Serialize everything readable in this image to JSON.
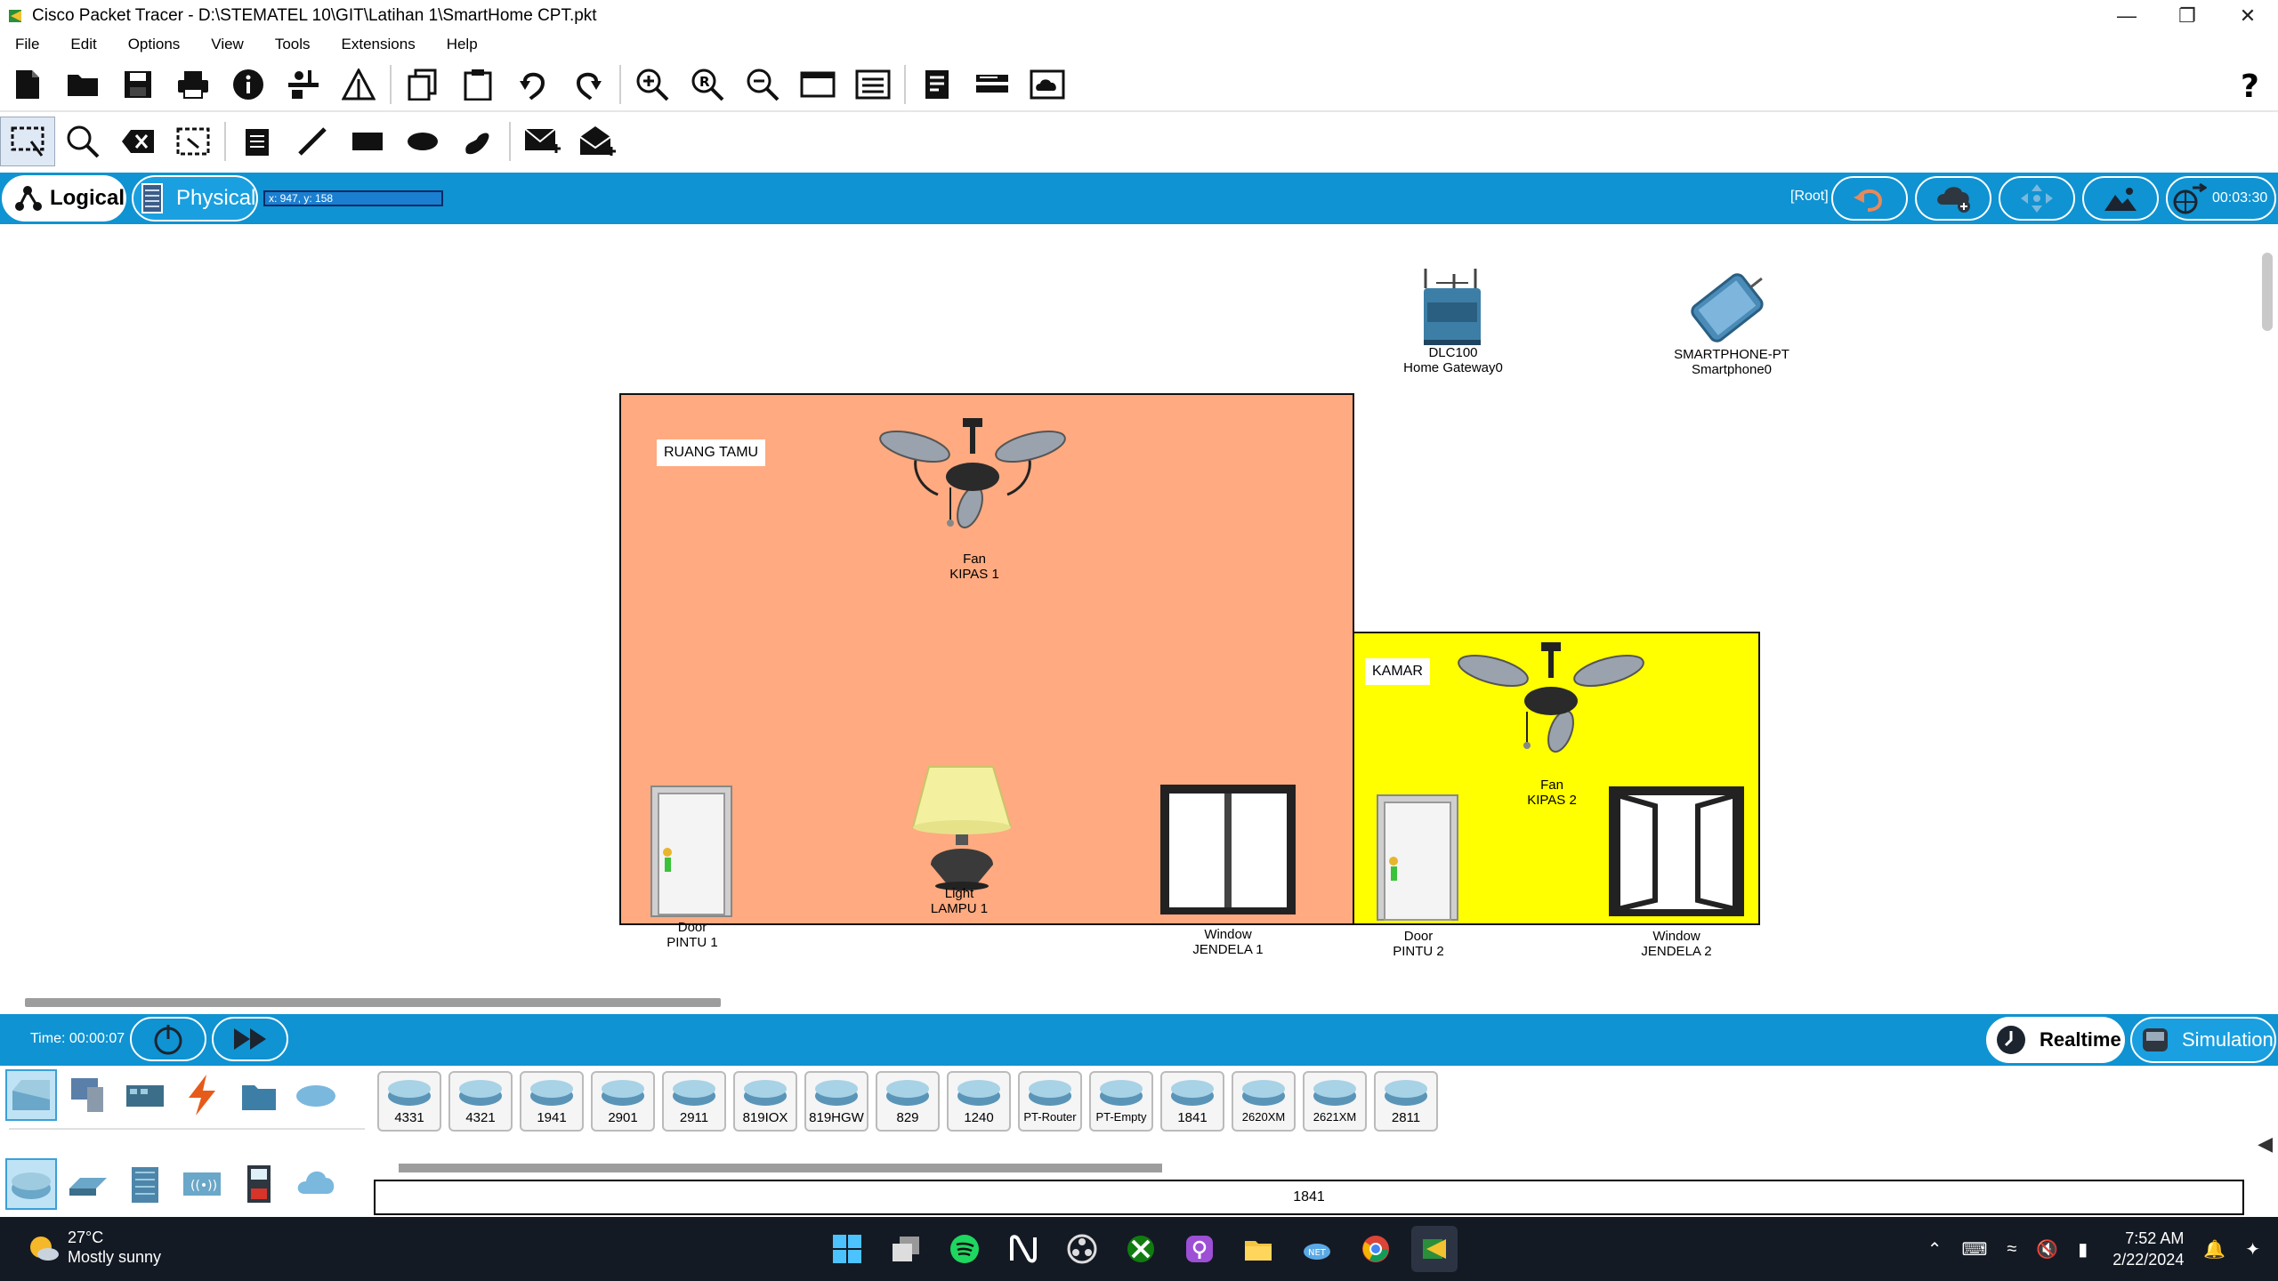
{
  "window": {
    "title": "Cisco Packet Tracer - D:\\STEMATEL 10\\GIT\\Latihan 1\\SmartHome CPT.pkt"
  },
  "menu": [
    "File",
    "Edit",
    "Options",
    "View",
    "Tools",
    "Extensions",
    "Help"
  ],
  "mode_bar": {
    "logical_label": "Logical",
    "physical_label": "Physical",
    "coords": "x: 947, y: 158",
    "root_label": "[Root]",
    "clock": "00:03:30"
  },
  "workspace": {
    "rooms": [
      {
        "label": "RUANG TAMU",
        "color": "#ffaa80"
      },
      {
        "label": "KAMAR",
        "color": "#ffff00"
      }
    ],
    "devices": [
      {
        "type": "DLC100",
        "name": "Home Gateway0"
      },
      {
        "type": "SMARTPHONE-PT",
        "name": "Smartphone0"
      },
      {
        "type": "Fan",
        "name": "KIPAS 1"
      },
      {
        "type": "Light",
        "name": "LAMPU 1"
      },
      {
        "type": "Door",
        "name": "PINTU 1"
      },
      {
        "type": "Window",
        "name": "JENDELA 1"
      },
      {
        "type": "Fan",
        "name": "KIPAS 2"
      },
      {
        "type": "Door",
        "name": "PINTU 2"
      },
      {
        "type": "Window",
        "name": "JENDELA 2"
      }
    ]
  },
  "timebar": {
    "time": "Time: 00:00:07",
    "realtime_label": "Realtime",
    "simulation_label": "Simulation"
  },
  "palette": {
    "models": [
      "4331",
      "4321",
      "1941",
      "2901",
      "2911",
      "819IOX",
      "819HGW",
      "829",
      "1240",
      "PT-Router",
      "PT-Empty",
      "1841",
      "2620XM",
      "2621XM",
      "2811"
    ],
    "selected_model": "1841"
  },
  "taskbar": {
    "temperature": "27°C",
    "weather": "Mostly sunny",
    "time": "7:52 AM",
    "date": "2/22/2024"
  },
  "colors": {
    "accent": "#0f93d2"
  }
}
